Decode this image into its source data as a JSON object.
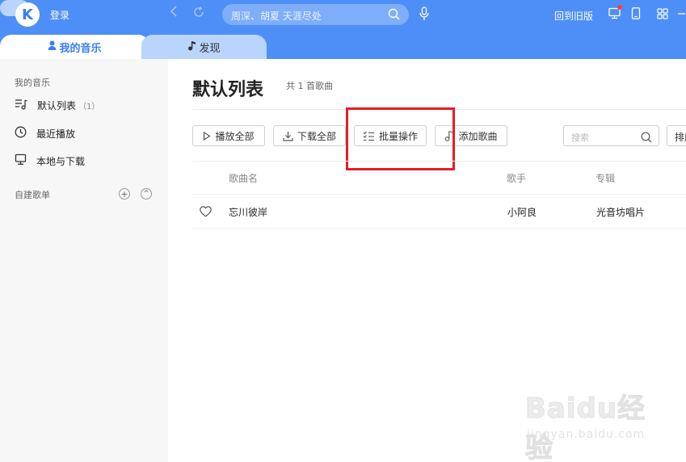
{
  "app": {
    "logo_letter": "K",
    "login_label": "登录",
    "search_placeholder": "周深、胡夏 天涯尽处",
    "old_version_label": "回到旧版"
  },
  "tabs": [
    {
      "label": "我的音乐",
      "active": true
    },
    {
      "label": "发现",
      "active": false
    }
  ],
  "sidebar": {
    "section_title": "我的音乐",
    "items": [
      {
        "label": "默认列表",
        "count": "（1）"
      },
      {
        "label": "最近播放"
      },
      {
        "label": "本地与下载"
      }
    ],
    "custom_section_title": "自建歌单",
    "add_symbol": "+",
    "collapse_symbol": "^"
  },
  "main": {
    "title": "默认列表",
    "song_count": "共 1 首歌曲",
    "buttons": {
      "play_all": "播放全部",
      "download_all": "下载全部",
      "batch": "批量操作",
      "add_song": "添加歌曲"
    },
    "search_placeholder": "搜索",
    "sort_label": "排序",
    "columns": {
      "song": "歌曲名",
      "artist": "歌手",
      "album": "专辑"
    },
    "rows": [
      {
        "song": "忘川彼岸",
        "artist": "小阿良",
        "album": "光音坊唱片"
      }
    ]
  },
  "colors": {
    "topbar": "#4d8ff7",
    "accent": "#3a7ef0",
    "highlight": "#e21f26"
  },
  "watermark": {
    "brand": "Baidu经验",
    "url": "jingyan.baidu.com"
  }
}
